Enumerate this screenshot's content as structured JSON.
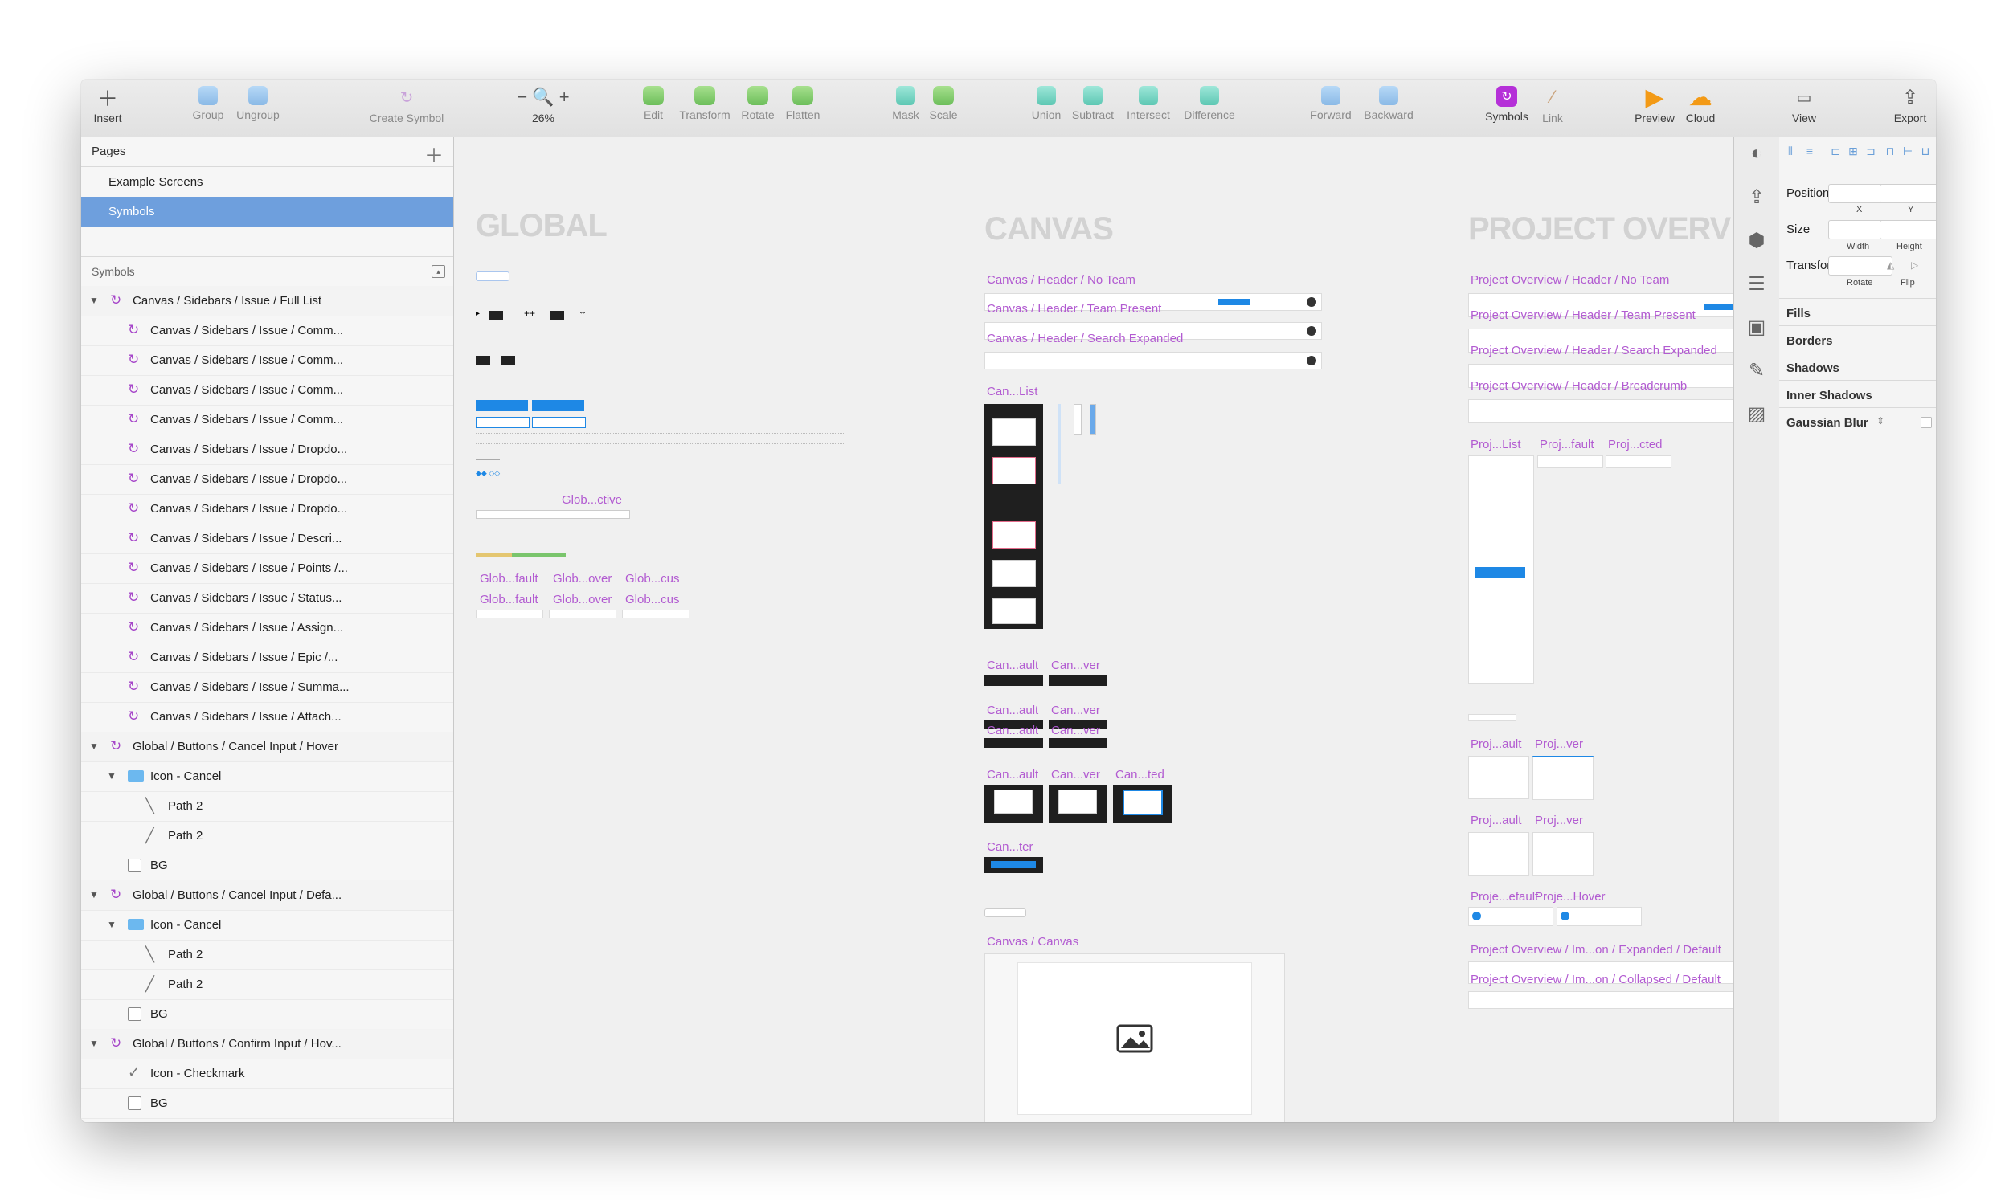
{
  "toolbar": {
    "insert": "Insert",
    "group": "Group",
    "ungroup": "Ungroup",
    "create_symbol": "Create Symbol",
    "zoom": "26%",
    "edit": "Edit",
    "transform": "Transform",
    "rotate": "Rotate",
    "flatten": "Flatten",
    "mask": "Mask",
    "scale": "Scale",
    "union": "Union",
    "subtract": "Subtract",
    "intersect": "Intersect",
    "difference": "Difference",
    "forward": "Forward",
    "backward": "Backward",
    "symbols": "Symbols",
    "link": "Link",
    "preview": "Preview",
    "cloud": "Cloud",
    "view": "View",
    "export": "Export"
  },
  "pages": {
    "header": "Pages",
    "items": [
      {
        "label": "Example Screens",
        "selected": false
      },
      {
        "label": "Symbols",
        "selected": true
      }
    ]
  },
  "layers": {
    "header": "Symbols",
    "items": [
      {
        "label": "Canvas / Sidebars / Issue / Full List",
        "kind": "symbol",
        "indent": 0,
        "expanded": true
      },
      {
        "label": "Canvas / Sidebars / Issue / Comm...",
        "kind": "symbol",
        "indent": 1
      },
      {
        "label": "Canvas / Sidebars / Issue / Comm...",
        "kind": "symbol",
        "indent": 1
      },
      {
        "label": "Canvas / Sidebars / Issue / Comm...",
        "kind": "symbol",
        "indent": 1
      },
      {
        "label": "Canvas / Sidebars / Issue / Comm...",
        "kind": "symbol",
        "indent": 1
      },
      {
        "label": "Canvas / Sidebars / Issue / Dropdo...",
        "kind": "symbol",
        "indent": 1
      },
      {
        "label": "Canvas / Sidebars / Issue / Dropdo...",
        "kind": "symbol",
        "indent": 1
      },
      {
        "label": "Canvas / Sidebars / Issue / Dropdo...",
        "kind": "symbol",
        "indent": 1
      },
      {
        "label": "Canvas / Sidebars / Issue / Descri...",
        "kind": "symbol",
        "indent": 1
      },
      {
        "label": "Canvas / Sidebars / Issue / Points /...",
        "kind": "symbol",
        "indent": 1
      },
      {
        "label": "Canvas / Sidebars / Issue / Status...",
        "kind": "symbol",
        "indent": 1
      },
      {
        "label": "Canvas / Sidebars / Issue / Assign...",
        "kind": "symbol",
        "indent": 1
      },
      {
        "label": "Canvas / Sidebars / Issue / Epic /...",
        "kind": "symbol",
        "indent": 1
      },
      {
        "label": "Canvas / Sidebars / Issue / Summa...",
        "kind": "symbol",
        "indent": 1
      },
      {
        "label": "Canvas / Sidebars / Issue / Attach...",
        "kind": "symbol",
        "indent": 1
      },
      {
        "label": "Global / Buttons / Cancel Input / Hover",
        "kind": "symbol",
        "indent": 0,
        "expanded": true
      },
      {
        "label": "Icon - Cancel",
        "kind": "folder",
        "indent": 1,
        "expanded": true
      },
      {
        "label": "Path 2",
        "kind": "path-back",
        "indent": 2
      },
      {
        "label": "Path 2",
        "kind": "path",
        "indent": 2
      },
      {
        "label": "BG",
        "kind": "rect",
        "indent": 1
      },
      {
        "label": "Global / Buttons / Cancel Input / Defa...",
        "kind": "symbol",
        "indent": 0,
        "expanded": true
      },
      {
        "label": "Icon - Cancel",
        "kind": "folder",
        "indent": 1,
        "expanded": true
      },
      {
        "label": "Path 2",
        "kind": "path-back",
        "indent": 2
      },
      {
        "label": "Path 2",
        "kind": "path",
        "indent": 2
      },
      {
        "label": "BG",
        "kind": "rect",
        "indent": 1
      },
      {
        "label": "Global / Buttons / Confirm Input / Hov...",
        "kind": "symbol",
        "indent": 0,
        "expanded": true
      },
      {
        "label": "Icon - Checkmark",
        "kind": "check",
        "indent": 1
      },
      {
        "label": "BG",
        "kind": "rect",
        "indent": 1
      }
    ]
  },
  "canvas": {
    "sections": {
      "global": "GLOBAL",
      "canvas": "CANVAS",
      "project": "PROJECT OVERV"
    },
    "global_labels": {
      "active": "Glob...ctive",
      "row1": [
        "Glob...fault",
        "Glob...over",
        "Glob...cus"
      ],
      "row2": [
        "Glob...fault",
        "Glob...over",
        "Glob...cus"
      ]
    },
    "canvas_labels": {
      "header_no_team": "Canvas / Header / No Team",
      "header_team": "Canvas / Header / Team Present",
      "header_search": "Canvas / Header / Search Expanded",
      "list": "Can...List",
      "r1": [
        "Can...ault",
        "Can...ver"
      ],
      "r2": [
        "Can...ault",
        "Can...ver"
      ],
      "r2b": [
        "Can...ault",
        "Can...ver"
      ],
      "r3": [
        "Can...ault",
        "Can...ver",
        "Can...ted"
      ],
      "footer": "Can...ter",
      "canvas_canvas": "Canvas / Canvas"
    },
    "project_labels": {
      "no_team": "Project Overview / Header / No Team",
      "team": "Project Overview / Header / Team Present",
      "search": "Project Overview / Header / Search Expanded",
      "breadcrumb": "Project Overview / Header / Breadcrumb",
      "list": "Proj...List",
      "fault": "Proj...fault",
      "cted": "Proj...cted",
      "r1": [
        "Proj...ault",
        "Proj...ver"
      ],
      "r2": [
        "Proj...ault",
        "Proj...ver"
      ],
      "r3": [
        "Proje...efault",
        "Proje...Hover"
      ],
      "expanded": "Project Overview / Im...on / Expanded / Default",
      "collapsed": "Project Overview / Im...on / Collapsed / Default"
    }
  },
  "inspector": {
    "position": "Position",
    "x": "X",
    "y": "Y",
    "size": "Size",
    "width": "Width",
    "height": "Height",
    "transform": "Transform",
    "rotate": "Rotate",
    "flip": "Flip",
    "fills": "Fills",
    "borders": "Borders",
    "shadows": "Shadows",
    "inner_shadows": "Inner Shadows",
    "gaussian_blur": "Gaussian Blur"
  }
}
